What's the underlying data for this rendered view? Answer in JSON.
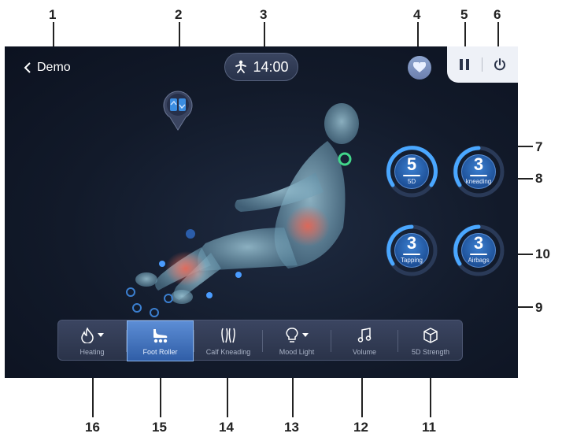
{
  "callouts": [
    "1",
    "2",
    "3",
    "4",
    "5",
    "6",
    "7",
    "8",
    "9",
    "10",
    "11",
    "12",
    "13",
    "14",
    "15",
    "16"
  ],
  "header": {
    "back_label": "Demo",
    "timer": "14:00"
  },
  "dials": [
    {
      "value": "5",
      "label": "5D"
    },
    {
      "value": "3",
      "label": "kneading"
    },
    {
      "value": "3",
      "label": "Tapping"
    },
    {
      "value": "3",
      "label": "Airbags"
    }
  ],
  "functions": [
    {
      "label": "Heating",
      "icon": "flame-icon"
    },
    {
      "label": "Foot Roller",
      "icon": "foot-roller-icon",
      "active": true
    },
    {
      "label": "Calf Kneading",
      "icon": "calf-icon"
    },
    {
      "label": "Mood Light",
      "icon": "bulb-icon"
    },
    {
      "label": "Volume",
      "icon": "music-note-icon"
    },
    {
      "label": "5D Strength",
      "icon": "cube-icon"
    }
  ],
  "colors": {
    "background": "#121a2a",
    "accent": "#3b7fd0",
    "arc": "#4aa7ff",
    "panel": "#2f3850",
    "heat": "#e06050"
  }
}
